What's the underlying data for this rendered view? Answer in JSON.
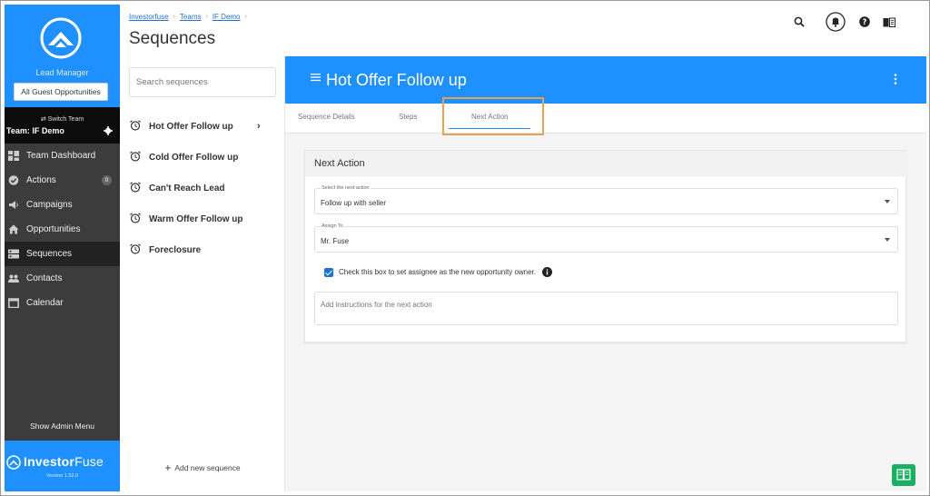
{
  "sidebar": {
    "lead_manager_label": "Lead Manager",
    "guest_opportunities_button": "All Guest Opportunities",
    "switch_team_label": "⇄ Switch Team",
    "team_name": "Team: IF Demo",
    "items": [
      {
        "label": "Team Dashboard",
        "icon": "dashboard-icon"
      },
      {
        "label": "Actions",
        "icon": "check-circle-icon",
        "badge": "0"
      },
      {
        "label": "Campaigns",
        "icon": "megaphone-icon"
      },
      {
        "label": "Opportunities",
        "icon": "home-icon"
      },
      {
        "label": "Sequences",
        "icon": "list-icon",
        "active": true
      },
      {
        "label": "Contacts",
        "icon": "people-icon"
      },
      {
        "label": "Calendar",
        "icon": "calendar-icon"
      }
    ],
    "admin_menu_label": "Show Admin Menu",
    "brand_bold": "Investor",
    "brand_thin": "Fuse",
    "version": "Version 1.52.0"
  },
  "header": {
    "breadcrumb": [
      "Investorfuse",
      "Teams",
      "IF Demo"
    ],
    "title": "Sequences",
    "icons": [
      "search-icon",
      "bell-icon",
      "help-icon",
      "book-icon"
    ]
  },
  "sequences": {
    "search_placeholder": "Search sequences",
    "items": [
      {
        "label": "Hot Offer Follow up",
        "selected": true
      },
      {
        "label": "Cold Offer Follow up"
      },
      {
        "label": "Can't Reach Lead"
      },
      {
        "label": "Warm Offer Follow up"
      },
      {
        "label": "Foreclosure"
      }
    ],
    "add_label": "Add new sequence"
  },
  "detail": {
    "title": "Hot Offer Follow up",
    "tabs": [
      "Sequence Details",
      "Steps",
      "Next Action"
    ],
    "active_tab": "Next Action",
    "card_title": "Next Action",
    "next_action_label": "Select the next action",
    "next_action_value": "Follow up with seller",
    "assign_label": "Assign To",
    "assign_value": "Mr. Fuse",
    "checkbox_label": "Check this box to set assignee as the new opportunity owner.",
    "checkbox_checked": true,
    "instructions_placeholder": "Add instructions for the next action"
  },
  "colors": {
    "accent": "#1e90ff",
    "sidebar_bg": "#3c3c3c",
    "highlight_box": "#e8a054",
    "help_button": "#1cae61"
  }
}
